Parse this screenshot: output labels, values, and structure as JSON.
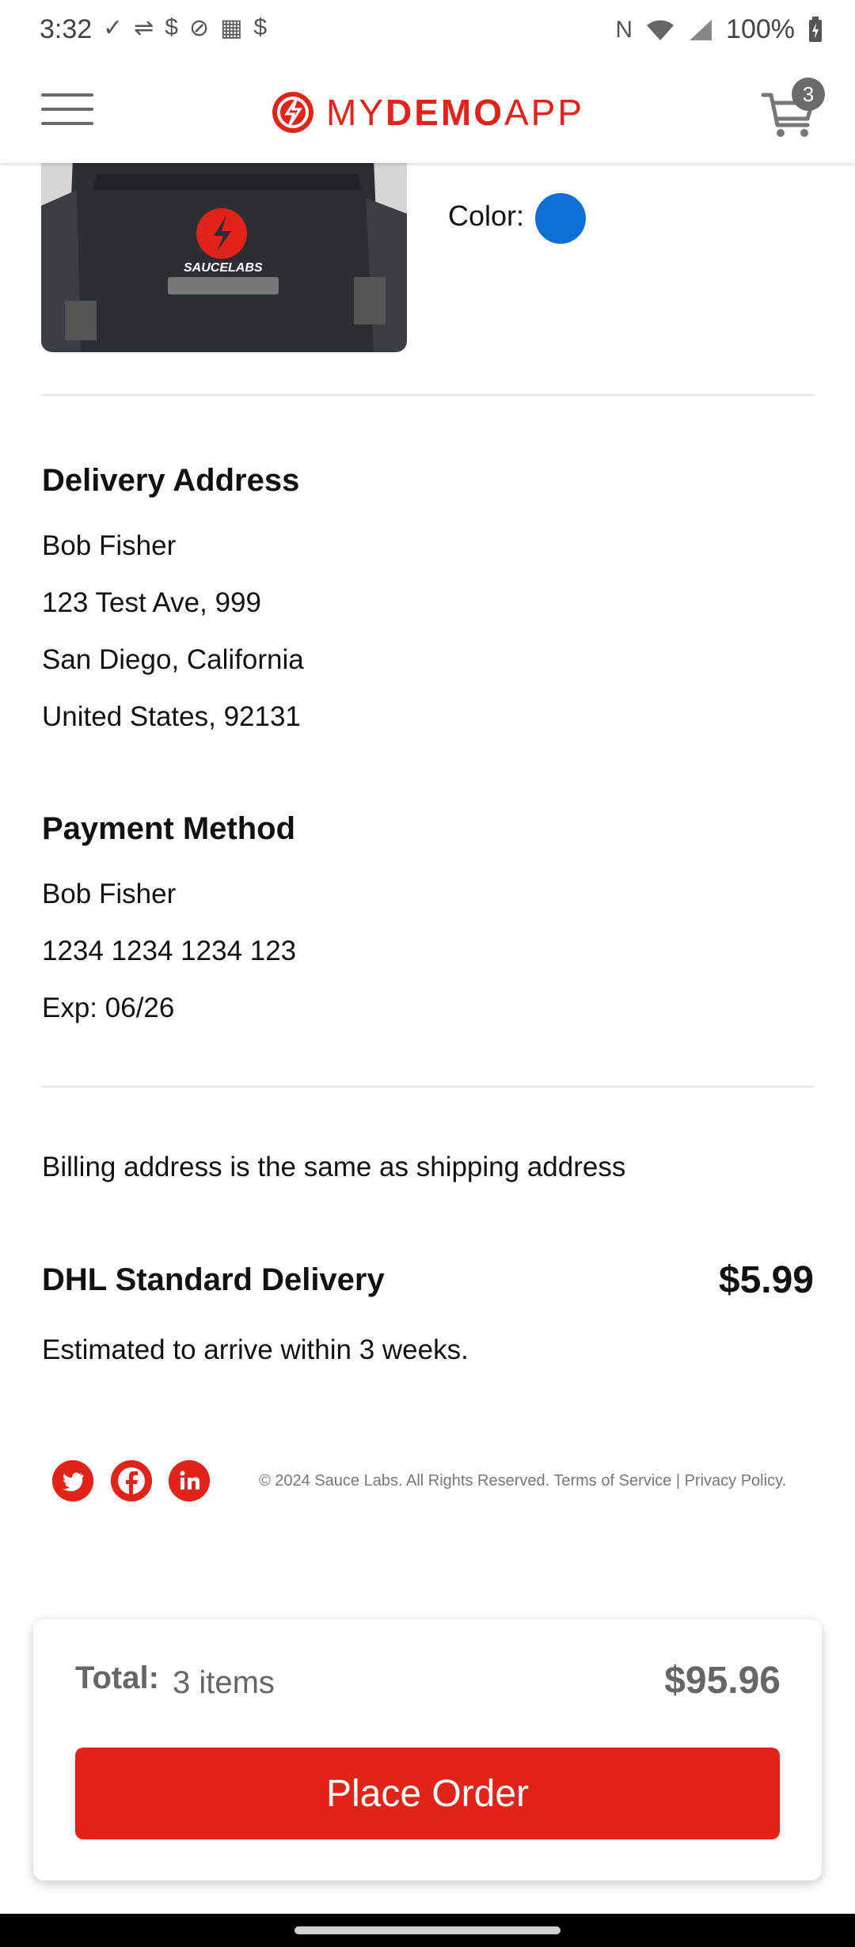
{
  "status_bar": {
    "time": "3:32",
    "battery": "100%",
    "icons_left": [
      "check-circle-icon",
      "usb-icon",
      "sim-icon",
      "no-sim-icon",
      "calendar-icon",
      "sim-icon"
    ],
    "icons_right": [
      "nfc-icon",
      "wifi-icon",
      "signal-icon",
      "battery-charging-icon"
    ]
  },
  "header": {
    "logo_my": "MY",
    "logo_demo": "DEMO",
    "logo_app": "APP",
    "cart_count": "3",
    "brand_color": "#e2231a"
  },
  "product": {
    "color_label": "Color:",
    "color_value": "#0d6fd8",
    "image_logo_text": "SAUCELABS"
  },
  "delivery_address": {
    "title": "Delivery Address",
    "lines": [
      "Bob Fisher",
      "123 Test Ave, 999",
      "San Diego, California",
      "United States, 92131"
    ]
  },
  "payment_method": {
    "title": "Payment Method",
    "lines": [
      "Bob Fisher",
      "1234 1234 1234 123",
      "Exp: 06/26"
    ]
  },
  "billing_note": "Billing address is the same as shipping address",
  "shipping": {
    "method": "DHL Standard Delivery",
    "price": "$5.99",
    "estimate": "Estimated to arrive within 3 weeks."
  },
  "footer": {
    "social": [
      "twitter-icon",
      "facebook-icon",
      "linkedin-icon"
    ],
    "copyright": "© 2024 Sauce Labs. All Rights Reserved. Terms of Service | Privacy Policy."
  },
  "order_summary": {
    "total_label": "Total:",
    "items": "3 items",
    "total_price": "$95.96",
    "place_order_label": "Place Order"
  }
}
